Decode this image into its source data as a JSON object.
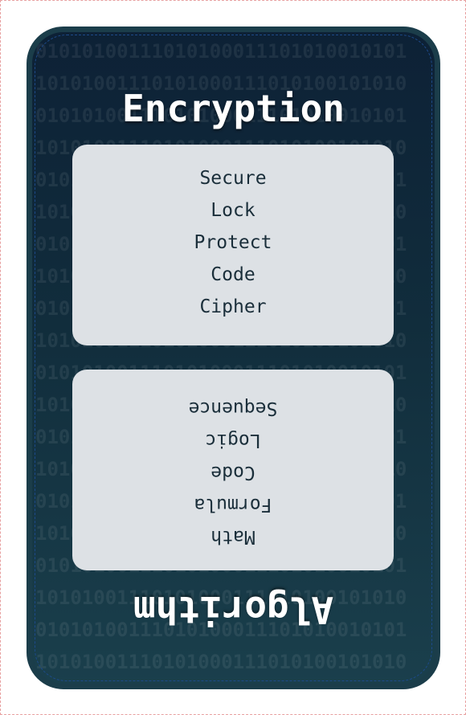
{
  "card": {
    "top_title": "Encryption",
    "bottom_title": "Algorithm",
    "top_words": [
      "Secure",
      "Lock",
      "Protect",
      "Code",
      "Cipher"
    ],
    "bottom_words": [
      "Math",
      "Formula",
      "Code",
      "Logic",
      "Sequence"
    ],
    "binary_rows": [
      "01010100111010100011101010010101",
      "10101001110101000111010100101010",
      "01010100111010100011101010010101",
      "10101001110101000111010100101010",
      "01010100111010100011101010010101",
      "10101001110101000111010100101010",
      "01010100111010100011101010010101",
      "10101001110101000111010100101010",
      "01010100111010100011101010010101",
      "10101001110101000111010100101010",
      "01010100111010100011101010010101",
      "10101001110101000111010100101010",
      "01010100111010100011101010010101",
      "10101001110101000111010100101010",
      "01010100111010100011101010010101",
      "10101001110101000111010100101010",
      "01010100111010100011101010010101",
      "10101001110101000111010100101010",
      "01010100111010100011101010010101",
      "10101001110101000111010100101010"
    ]
  },
  "colors": {
    "card_top": "#0d2136",
    "card_bottom": "#1a3f4c",
    "card_border": "#1b3d4a",
    "panel": "#dde1e5",
    "text_dark": "#1a2e3a",
    "title": "#ffffff"
  }
}
